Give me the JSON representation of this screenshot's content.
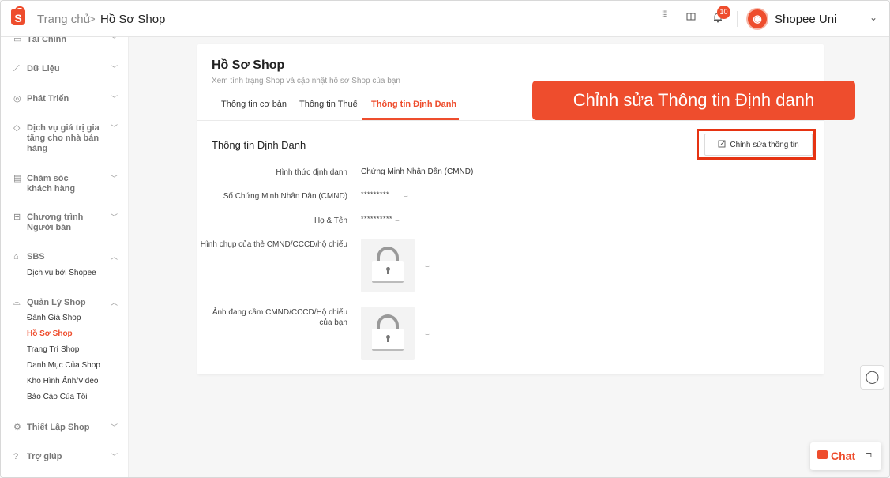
{
  "header": {
    "logo_letter": "S",
    "breadcrumb_home": "Trang chủ",
    "breadcrumb_sep": ">",
    "breadcrumb_current": "Hồ Sơ Shop",
    "notification_count": "10",
    "account_name": "Shopee Uni",
    "icons": [
      "apps-icon",
      "book-icon",
      "bell-icon",
      "chevron-down-icon"
    ]
  },
  "sidebar": {
    "groups": [
      {
        "label": "Tài Chính",
        "icon": "wallet-icon",
        "expanded": false
      },
      {
        "label": "Dữ Liệu",
        "icon": "chart-icon",
        "expanded": false
      },
      {
        "label": "Phát Triển",
        "icon": "growth-icon",
        "expanded": false
      },
      {
        "label": "Dịch vụ giá trị gia tăng cho nhà bán hàng",
        "icon": "diamond-icon",
        "expanded": false
      },
      {
        "label": "Chăm sóc khách hàng",
        "icon": "chat-icon",
        "expanded": false
      },
      {
        "label": "Chương trình Người bán",
        "icon": "program-icon",
        "expanded": false
      },
      {
        "label": "SBS",
        "icon": "warehouse-icon",
        "expanded": true,
        "items": [
          "Dịch vụ bởi Shopee"
        ]
      },
      {
        "label": "Quản Lý Shop",
        "icon": "shop-icon",
        "expanded": true,
        "items": [
          "Đánh Giá Shop",
          "Hồ Sơ Shop",
          "Trang Trí Shop",
          "Danh Mục Của Shop",
          "Kho Hình Ảnh/Video",
          "Báo Cáo Của Tôi"
        ],
        "active_item": "Hồ Sơ Shop"
      },
      {
        "label": "Thiết Lập Shop",
        "icon": "settings-icon",
        "expanded": false
      },
      {
        "label": "Trợ giúp",
        "icon": "help-icon",
        "expanded": false
      }
    ]
  },
  "main": {
    "title": "Hồ Sơ Shop",
    "subtitle": "Xem tình trạng Shop và cập nhật hồ sơ Shop của bạn",
    "tabs": [
      {
        "label": "Thông tin cơ bản",
        "active": false
      },
      {
        "label": "Thông tin Thuế",
        "active": false
      },
      {
        "label": "Thông tin Định Danh",
        "active": true
      }
    ],
    "section_title": "Thông tin Định Danh",
    "edit_button_label": "Chỉnh sửa thông tin",
    "annotation": "Chỉnh sửa Thông tin Định danh",
    "fields": [
      {
        "label": "Hình thức định danh",
        "value": "Chứng Minh Nhân Dân (CMND)"
      },
      {
        "label": "Số Chứng Minh Nhân Dân (CMND)",
        "value": "*********"
      },
      {
        "label": "Họ & Tên",
        "value": "**********"
      },
      {
        "label": "Hình chụp của thẻ CMND/CCCD/hộ chiếu",
        "value_type": "locked-image"
      },
      {
        "label": "Ảnh đang cầm CMND/CCCD/Hộ chiếu của bạn",
        "value_type": "locked-image"
      }
    ]
  },
  "floating": {
    "chat_label": "Chat",
    "support_icon": "headset-icon"
  },
  "colors": {
    "brand": "#ee4d2d",
    "highlight_border": "#e63312",
    "background": "#f6f6f6"
  }
}
